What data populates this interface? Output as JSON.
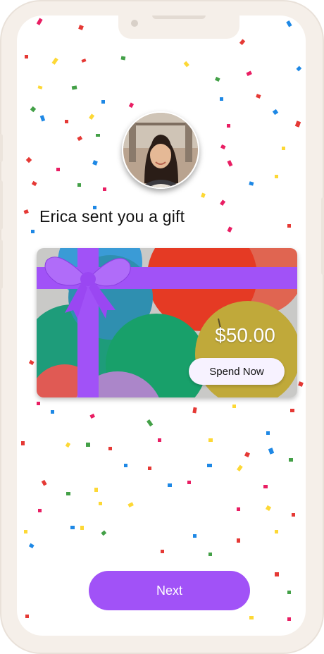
{
  "greeting": {
    "sender_name": "Erica",
    "headline": "Erica sent you a gift"
  },
  "gift_card": {
    "amount": "$50.00",
    "spend_label": "Spend Now"
  },
  "footer": {
    "next_label": "Next"
  },
  "colors": {
    "accent": "#a152f7",
    "frame": "#f5efe9",
    "confetti": [
      "#e53935",
      "#1e88e5",
      "#43a047",
      "#fdd835",
      "#e91e63",
      "#ff9800"
    ]
  },
  "icons": {
    "avatar": "user-photo",
    "card_art": "balloons-image",
    "bow": "gift-bow-icon"
  }
}
